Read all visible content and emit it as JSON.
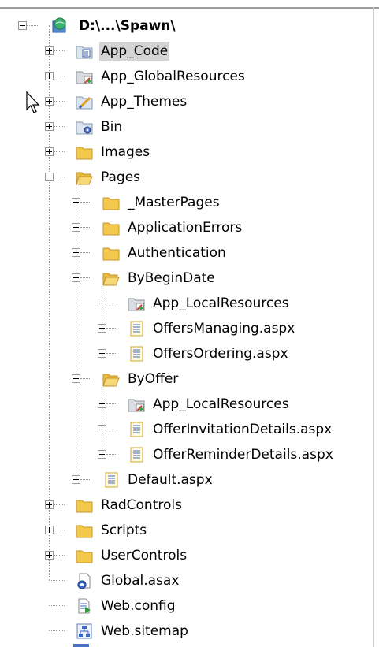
{
  "tree": {
    "root": {
      "label": "D:\\...\\Spawn\\",
      "icon": "web-project-icon"
    },
    "items": [
      {
        "label": "App_Code",
        "icon": "folder-app-code-icon",
        "selected": true
      },
      {
        "label": "App_GlobalResources",
        "icon": "folder-resources-icon"
      },
      {
        "label": "App_Themes",
        "icon": "folder-themes-icon"
      },
      {
        "label": "Bin",
        "icon": "folder-bin-icon"
      },
      {
        "label": "Images",
        "icon": "folder-icon"
      },
      {
        "label": "Pages",
        "icon": "folder-open-icon"
      },
      {
        "label": "_MasterPages",
        "icon": "folder-icon"
      },
      {
        "label": "ApplicationErrors",
        "icon": "folder-icon"
      },
      {
        "label": "Authentication",
        "icon": "folder-icon"
      },
      {
        "label": "ByBeginDate",
        "icon": "folder-open-icon"
      },
      {
        "label": "App_LocalResources",
        "icon": "folder-resources-icon"
      },
      {
        "label": "OffersManaging.aspx",
        "icon": "aspx-page-icon"
      },
      {
        "label": "OffersOrdering.aspx",
        "icon": "aspx-page-icon"
      },
      {
        "label": "ByOffer",
        "icon": "folder-open-icon"
      },
      {
        "label": "App_LocalResources",
        "icon": "folder-resources-icon"
      },
      {
        "label": "OfferInvitationDetails.aspx",
        "icon": "aspx-page-icon"
      },
      {
        "label": "OfferReminderDetails.aspx",
        "icon": "aspx-page-icon"
      },
      {
        "label": "Default.aspx",
        "icon": "aspx-page-icon"
      },
      {
        "label": "RadControls",
        "icon": "folder-icon"
      },
      {
        "label": "Scripts",
        "icon": "folder-icon"
      },
      {
        "label": "UserControls",
        "icon": "folder-icon"
      },
      {
        "label": "Global.asax",
        "icon": "global-asax-icon"
      },
      {
        "label": "Web.config",
        "icon": "web-config-icon"
      },
      {
        "label": "Web.sitemap",
        "icon": "sitemap-icon"
      }
    ]
  },
  "colors": {
    "folder": "#f2c94c",
    "folder_dark": "#c9962a",
    "selection": "#d4d4d4",
    "tree_line": "#9a9a9a"
  }
}
